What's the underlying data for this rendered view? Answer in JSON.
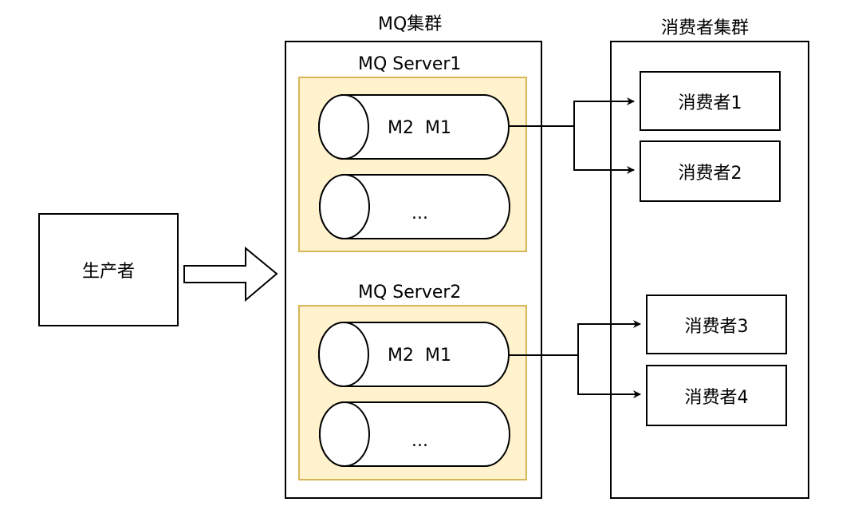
{
  "mq_cluster": {
    "title": "MQ集群",
    "servers": [
      {
        "title": "MQ Server1",
        "queues": [
          "M2  M1",
          "..."
        ]
      },
      {
        "title": "MQ Server2",
        "queues": [
          "M2  M1",
          "..."
        ]
      }
    ]
  },
  "consumer_cluster": {
    "title": "消费者集群",
    "consumers": [
      "消费者1",
      "消费者2",
      "消费者3",
      "消费者4"
    ]
  },
  "producer": {
    "label": "生产者"
  },
  "colors": {
    "server_fill": "#fff2cc",
    "server_border": "#d6b656",
    "line": "#000000"
  }
}
